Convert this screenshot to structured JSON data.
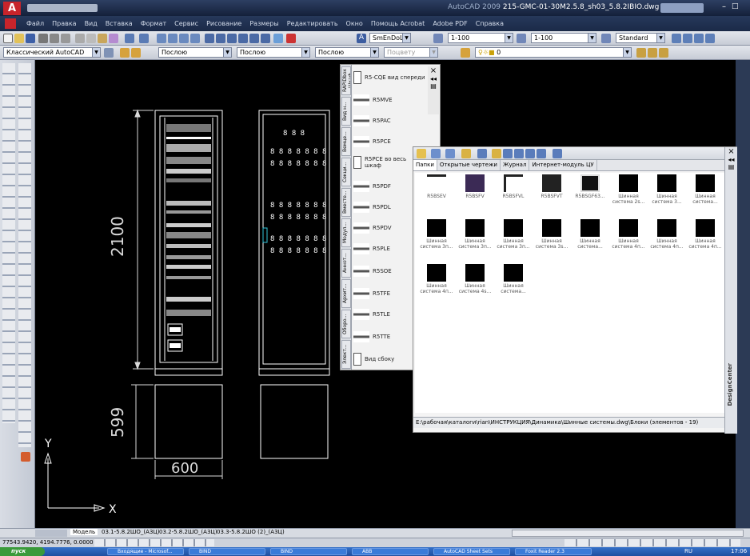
{
  "window": {
    "title": "AutoCAD 2009 215-GMC-01-30M2.5.8_sh03_5.8.2ΙΒΙO.dwg",
    "app_name": "AutoCAD 2009",
    "doc_name": "215-GMC-01-30M2.5.8_sh03_5.8.2ΙΒΙO.dwg"
  },
  "menu": [
    "Файл",
    "Правка",
    "Вид",
    "Вставка",
    "Формат",
    "Сервис",
    "Рисование",
    "Размеры",
    "Редактировать",
    "Окно",
    "Помощь Acrobat",
    "Adobe PDF",
    "Справка"
  ],
  "toolbar": {
    "text_style": "SmEnDoL Text",
    "dim_scale": "1-100",
    "annot_scale": "1-100",
    "table_style": "Standard",
    "workspace": "Классический AutoCAD",
    "color": "Послою",
    "linetype": "Послою",
    "lineweight": "Послою",
    "plotstyle": "Поцвету",
    "layer": "0"
  },
  "drawing": {
    "dim_height": "2100",
    "dim_base": "599",
    "dim_width": "600",
    "ucs_x": "X",
    "ucs_y": "Y"
  },
  "palette": {
    "tabs": [
      "RAPIDbox Шкаф",
      "Вид н...",
      "Вемце...",
      "Секци...",
      "Вместе...",
      "Модул...",
      "Аннот...",
      "Архит...",
      "Оборо...",
      "Элект..."
    ],
    "items": [
      "R5-CQE вид спереди",
      "R5MVE",
      "R5PAC",
      "R5PCE",
      "R5PCE во весь шкаф",
      "R5PDF",
      "R5PDL",
      "R5PDV",
      "R5PLE",
      "R5SOE",
      "R5TFE",
      "R5TLE",
      "R5TTE",
      "Вид сбоку"
    ]
  },
  "design_center": {
    "tabs": [
      "Папки",
      "Открытые чертежи",
      "Журнал",
      "Интернет-модуль ЦУ"
    ],
    "items": [
      "R5BSEV",
      "R5BSFV",
      "R5BSFVL",
      "R5BSFVT",
      "R5BSGF63...",
      "Шинная система 2s...",
      "Шинная система 3...",
      "Шинная система...",
      "Шинная система 3п...",
      "Шинная система 3п...",
      "Шинная система 3п...",
      "Шинная система 3s...",
      "Шинная система...",
      "Шинная система 4п...",
      "Шинная система 4п...",
      "Шинная система 4п...",
      "Шинная система 4п...",
      "Шинная система 4s...",
      "Шинная система..."
    ],
    "status": "E:\\рабочая\\каталоги\\rian\\ИНСТРУКЦИЯ\\Динамика\\Шинные системы.dwg\\Блоки (элементов - 19)",
    "side_label": "DesignCenter"
  },
  "layout_tabs": [
    "Модель",
    "03.1-5.8.2ШО_(А3Ц)",
    "03.2-5.8.2ШО_(А3Ц)",
    "03.3-5.8.2ШО (2)_(А3Ц)"
  ],
  "status": {
    "coords": "77543.9420, 4194.7776, 0.0000"
  },
  "taskbar": {
    "start": "пуск",
    "tasks": [
      "Входящие - Microsof...",
      "BIND",
      "BIND",
      "ABB",
      "AutoCAD Sheet Sets",
      "Foxit Reader 2.3"
    ],
    "lang": "RU",
    "clock": "17:06"
  },
  "colors": {
    "title_bg": "#1d2c4c",
    "canvas": "#000000",
    "cad_lines": "#ffffff",
    "dim_lines": "#d9d9d9"
  }
}
